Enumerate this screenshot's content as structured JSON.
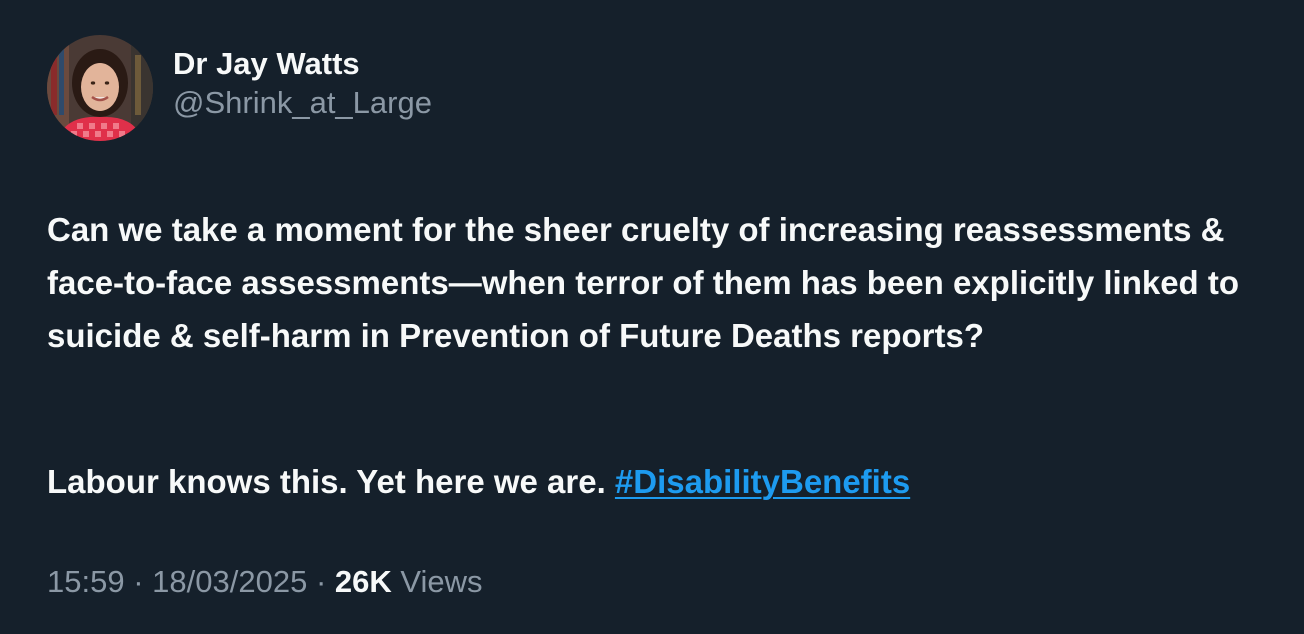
{
  "author": {
    "display_name": "Dr Jay Watts",
    "handle": "@Shrink_at_Large",
    "avatar_icon": "profile-photo"
  },
  "tweet": {
    "paragraph_1": "Can we take a moment for the sheer cruelty of increasing reassessments & face-to-face assessments—when terror of them has been explicitly linked to suicide & self-harm in Prevention of Future Deaths reports?",
    "paragraph_2_text": "Labour knows this. Yet here we are. ",
    "hashtag": "#DisabilityBenefits"
  },
  "meta": {
    "time": "15:59",
    "separator": "·",
    "date": "18/03/2025",
    "views_count": "26K",
    "views_label": "Views"
  },
  "colors": {
    "background": "#15202b",
    "text_primary": "#f7f9f9",
    "text_secondary": "#8b98a5",
    "link": "#1d9bf0"
  }
}
